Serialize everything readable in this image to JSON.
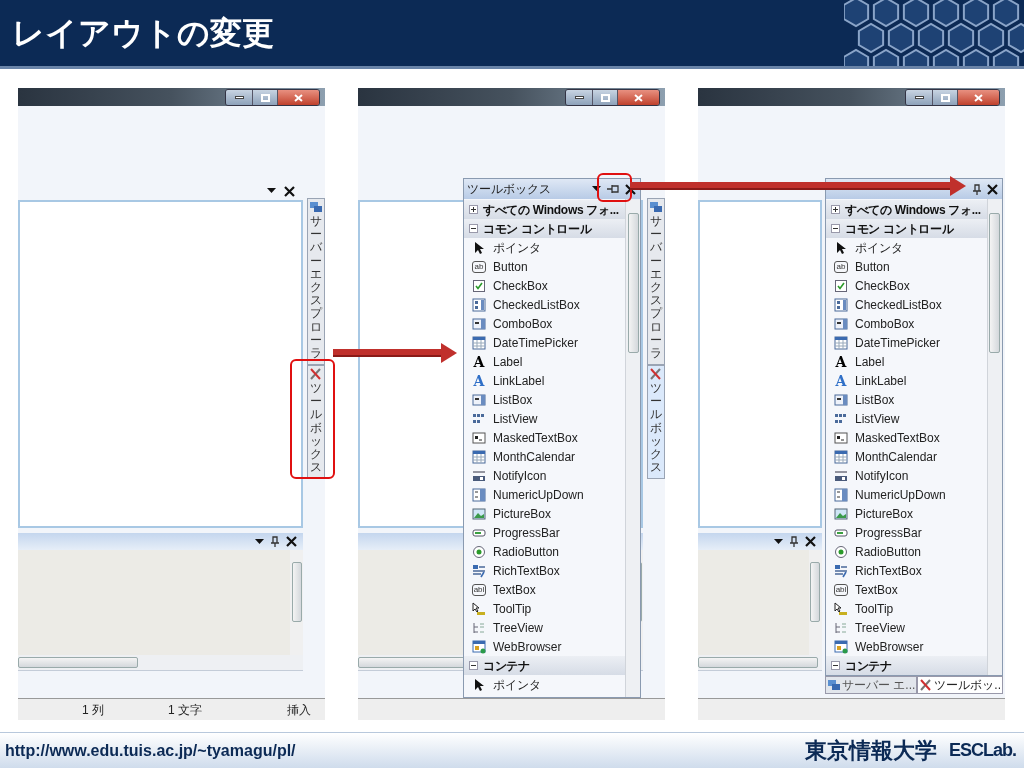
{
  "slide": {
    "title": "レイアウトの変更",
    "url": "http://www.edu.tuis.ac.jp/~tyamagu/pl/",
    "university": "東京情報大学",
    "lab_logo": "ESCLab."
  },
  "screenshots": [
    {
      "kind": "collapsed",
      "side_tabs": [
        {
          "label": "サーバーエクスプローラ",
          "kind": "server",
          "selected": false,
          "circled": false
        },
        {
          "label": "ツールボックス",
          "kind": "tools",
          "selected": false,
          "circled": true
        }
      ],
      "status_bar": [
        "1 列",
        "1 文字",
        "挿入"
      ]
    },
    {
      "kind": "floating",
      "side_tabs": [
        {
          "label": "サーバーエクスプローラ",
          "kind": "server",
          "selected": false,
          "circled": false
        },
        {
          "label": "ツールボックス",
          "kind": "tools",
          "selected": true,
          "circled": false
        }
      ],
      "toolbox": {
        "title": "ツールボックス",
        "pinned": false,
        "pin_circled": true,
        "groups": [
          {
            "label": "すべての Windows フォ...",
            "expanded": false
          },
          {
            "label": "コモン コントロール",
            "expanded": true,
            "items": [
              {
                "label": "ポインタ",
                "kind": "pointer"
              },
              {
                "label": "Button",
                "kind": "glyph",
                "glyph": "ab"
              },
              {
                "label": "CheckBox",
                "kind": "checkbox"
              },
              {
                "label": "CheckedListBox",
                "kind": "checkedlist"
              },
              {
                "label": "ComboBox",
                "kind": "combo"
              },
              {
                "label": "DateTimePicker",
                "kind": "calendar"
              },
              {
                "label": "Label",
                "kind": "letter",
                "glyph": "A"
              },
              {
                "label": "LinkLabel",
                "kind": "link",
                "glyph": "A"
              },
              {
                "label": "ListBox",
                "kind": "combo"
              },
              {
                "label": "ListView",
                "kind": "listview"
              },
              {
                "label": "MaskedTextBox",
                "kind": "masked"
              },
              {
                "label": "MonthCalendar",
                "kind": "calendar"
              },
              {
                "label": "NotifyIcon",
                "kind": "notify"
              },
              {
                "label": "NumericUpDown",
                "kind": "numeric"
              },
              {
                "label": "PictureBox",
                "kind": "picture"
              },
              {
                "label": "ProgressBar",
                "kind": "progress"
              },
              {
                "label": "RadioButton",
                "kind": "radio"
              },
              {
                "label": "RichTextBox",
                "kind": "rich"
              },
              {
                "label": "TextBox",
                "kind": "glyph",
                "glyph": "abl"
              },
              {
                "label": "ToolTip",
                "kind": "tooltip"
              },
              {
                "label": "TreeView",
                "kind": "tree"
              },
              {
                "label": "WebBrowser",
                "kind": "browser"
              }
            ]
          },
          {
            "label": "コンテナ",
            "expanded": true,
            "items": [
              {
                "label": "ポインタ",
                "kind": "pointer"
              }
            ]
          }
        ]
      }
    },
    {
      "kind": "docked",
      "toolbox": {
        "pinned": true,
        "groups": [
          {
            "label": "すべての Windows フォ...",
            "expanded": false
          },
          {
            "label": "コモン コントロール",
            "expanded": true,
            "items": [
              {
                "label": "ポインタ",
                "kind": "pointer"
              },
              {
                "label": "Button",
                "kind": "glyph",
                "glyph": "ab"
              },
              {
                "label": "CheckBox",
                "kind": "checkbox"
              },
              {
                "label": "CheckedListBox",
                "kind": "checkedlist"
              },
              {
                "label": "ComboBox",
                "kind": "combo"
              },
              {
                "label": "DateTimePicker",
                "kind": "calendar"
              },
              {
                "label": "Label",
                "kind": "letter",
                "glyph": "A"
              },
              {
                "label": "LinkLabel",
                "kind": "link",
                "glyph": "A"
              },
              {
                "label": "ListBox",
                "kind": "combo"
              },
              {
                "label": "ListView",
                "kind": "listview"
              },
              {
                "label": "MaskedTextBox",
                "kind": "masked"
              },
              {
                "label": "MonthCalendar",
                "kind": "calendar"
              },
              {
                "label": "NotifyIcon",
                "kind": "notify"
              },
              {
                "label": "NumericUpDown",
                "kind": "numeric"
              },
              {
                "label": "PictureBox",
                "kind": "picture"
              },
              {
                "label": "ProgressBar",
                "kind": "progress"
              },
              {
                "label": "RadioButton",
                "kind": "radio"
              },
              {
                "label": "RichTextBox",
                "kind": "rich"
              },
              {
                "label": "TextBox",
                "kind": "glyph",
                "glyph": "abl"
              },
              {
                "label": "ToolTip",
                "kind": "tooltip"
              },
              {
                "label": "TreeView",
                "kind": "tree"
              },
              {
                "label": "WebBrowser",
                "kind": "browser"
              }
            ]
          },
          {
            "label": "コンテナ",
            "expanded": true
          }
        ]
      },
      "bottom_tabs": [
        {
          "label": "サーバー エ...",
          "kind": "server",
          "selected": false
        },
        {
          "label": "ツールボッ..",
          "kind": "tools",
          "selected": true
        }
      ]
    }
  ]
}
